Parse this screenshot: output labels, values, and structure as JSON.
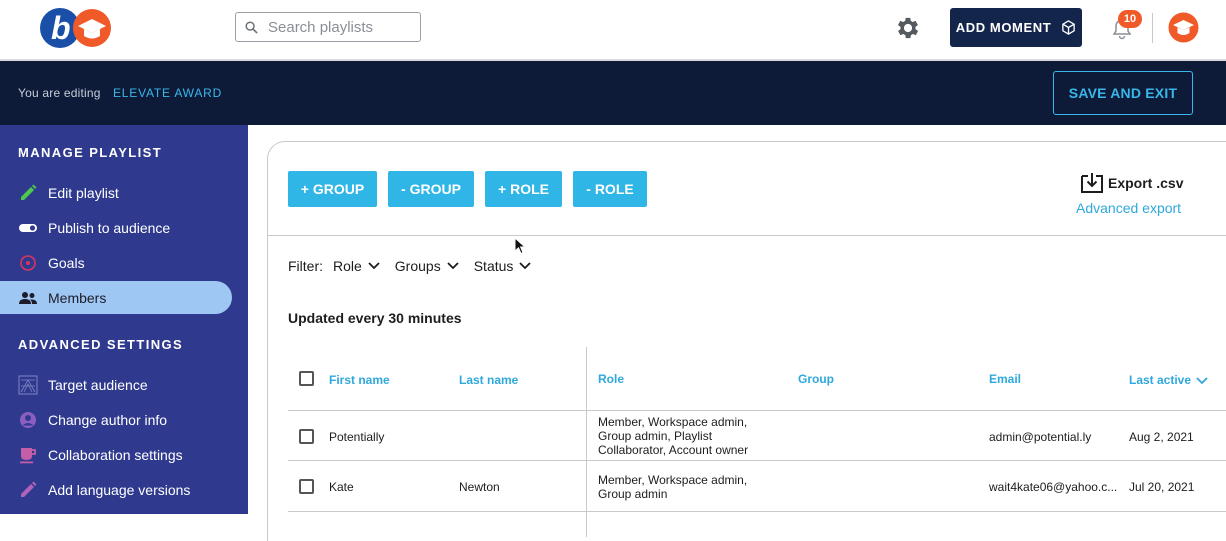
{
  "header": {
    "search_placeholder": "Search playlists",
    "add_moment_label": "ADD MOMENT",
    "notification_count": "10",
    "colors": {
      "navy": "#14254b",
      "accent": "#3ab7ea",
      "brand_orange": "#f05a28",
      "brand_blue": "#1a4fa8"
    }
  },
  "editbar": {
    "editing_text": "You are editing",
    "playlist_name": "ELEVATE AWARD",
    "save_exit_label": "SAVE AND EXIT"
  },
  "sidebar": {
    "manage_heading": "MANAGE PLAYLIST",
    "manage_items": [
      {
        "label": "Edit playlist",
        "icon": "pencil-icon"
      },
      {
        "label": "Publish to audience",
        "icon": "toggle-icon"
      },
      {
        "label": "Goals",
        "icon": "target-icon"
      },
      {
        "label": "Members",
        "icon": "people-icon",
        "active": true
      }
    ],
    "advanced_heading": "ADVANCED SETTINGS",
    "advanced_items": [
      {
        "label": "Target audience",
        "icon": "target-audience-icon"
      },
      {
        "label": "Change author info",
        "icon": "person-icon"
      },
      {
        "label": "Collaboration settings",
        "icon": "cup-icon"
      },
      {
        "label": "Add language versions",
        "icon": "pencil-icon"
      }
    ]
  },
  "toolbar": {
    "buttons": [
      "+ GROUP",
      "- GROUP",
      "+ ROLE",
      "- ROLE"
    ],
    "export_label": "Export .csv",
    "advanced_export_label": "Advanced export"
  },
  "filter": {
    "label": "Filter:",
    "options": [
      "Role",
      "Groups",
      "Status"
    ]
  },
  "updated_text": "Updated every 30 minutes",
  "table": {
    "columns": [
      "First name",
      "Last name",
      "Role",
      "Group",
      "Email",
      "Last active"
    ],
    "rows": [
      {
        "first_name": "Potentially",
        "last_name": "",
        "role_lines": [
          "Member, Workspace admin,",
          "Group admin, Playlist",
          "Collaborator, Account owner"
        ],
        "group": "",
        "email": "admin@potential.ly",
        "last_active": "Aug 2, 2021"
      },
      {
        "first_name": "Kate",
        "last_name": "Newton",
        "role_lines": [
          "Member, Workspace admin,",
          "Group admin"
        ],
        "group": "",
        "email": "wait4kate06@yahoo.c...",
        "last_active": "Jul 20, 2021"
      }
    ]
  }
}
